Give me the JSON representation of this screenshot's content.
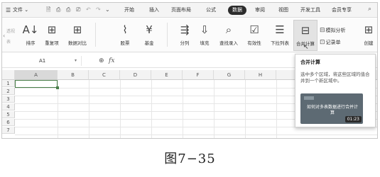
{
  "menubar": {
    "file_label": "文件",
    "tabs": [
      {
        "label": "开始"
      },
      {
        "label": "插入"
      },
      {
        "label": "页面布局"
      },
      {
        "label": "公式"
      },
      {
        "label": "数据"
      },
      {
        "label": "审阅"
      },
      {
        "label": "视图"
      },
      {
        "label": "开发工具"
      },
      {
        "label": "会员专享"
      }
    ],
    "active_tab": "数据"
  },
  "ribbon": {
    "left_side": [
      "透视",
      "表"
    ],
    "buttons": [
      {
        "label": "排序",
        "icon": "sort-az-icon",
        "glyph": "A↓"
      },
      {
        "label": "重复项",
        "icon": "duplicate-icon",
        "glyph": "⊞"
      },
      {
        "label": "数据对比",
        "icon": "compare-icon",
        "glyph": "⊞"
      },
      {
        "label": "股票",
        "icon": "stock-chart-icon",
        "glyph": "⌇"
      },
      {
        "label": "基金",
        "icon": "fund-icon",
        "glyph": "¥"
      },
      {
        "label": "分列",
        "icon": "split-column-icon",
        "glyph": "⇶"
      },
      {
        "label": "填充",
        "icon": "fill-icon",
        "glyph": "⇩"
      },
      {
        "label": "查找录入",
        "icon": "lookup-entry-icon",
        "glyph": "⌕"
      },
      {
        "label": "有效性",
        "icon": "validation-icon",
        "glyph": "☑"
      },
      {
        "label": "下拉列表",
        "icon": "dropdown-list-icon",
        "glyph": "☰"
      },
      {
        "label": "合并计算",
        "icon": "consolidate-icon",
        "glyph": "⊟"
      },
      {
        "label": "创建",
        "icon": "create-group-icon",
        "glyph": "⊞"
      }
    ],
    "small_buttons": [
      {
        "label": "模拟分析",
        "icon": "what-if-icon"
      },
      {
        "label": "记录单",
        "icon": "record-form-icon"
      }
    ]
  },
  "formula_bar": {
    "cell_ref": "A1",
    "zoom_icon": "zoom-icon",
    "fx_label": "fx"
  },
  "grid": {
    "columns": [
      "A",
      "B",
      "C",
      "D",
      "E",
      "F",
      "G",
      "H"
    ],
    "rows": [
      "1",
      "2",
      "3",
      "4",
      "5",
      "6",
      "7"
    ],
    "selected_cell": "A1"
  },
  "tooltip": {
    "title": "合并计算",
    "description": "选中多个区域，将这些区域的值合并到一个新区域中。",
    "video_text": "如何对多表数据进行合并计算",
    "duration": "01:23"
  },
  "caption": "图7−35"
}
